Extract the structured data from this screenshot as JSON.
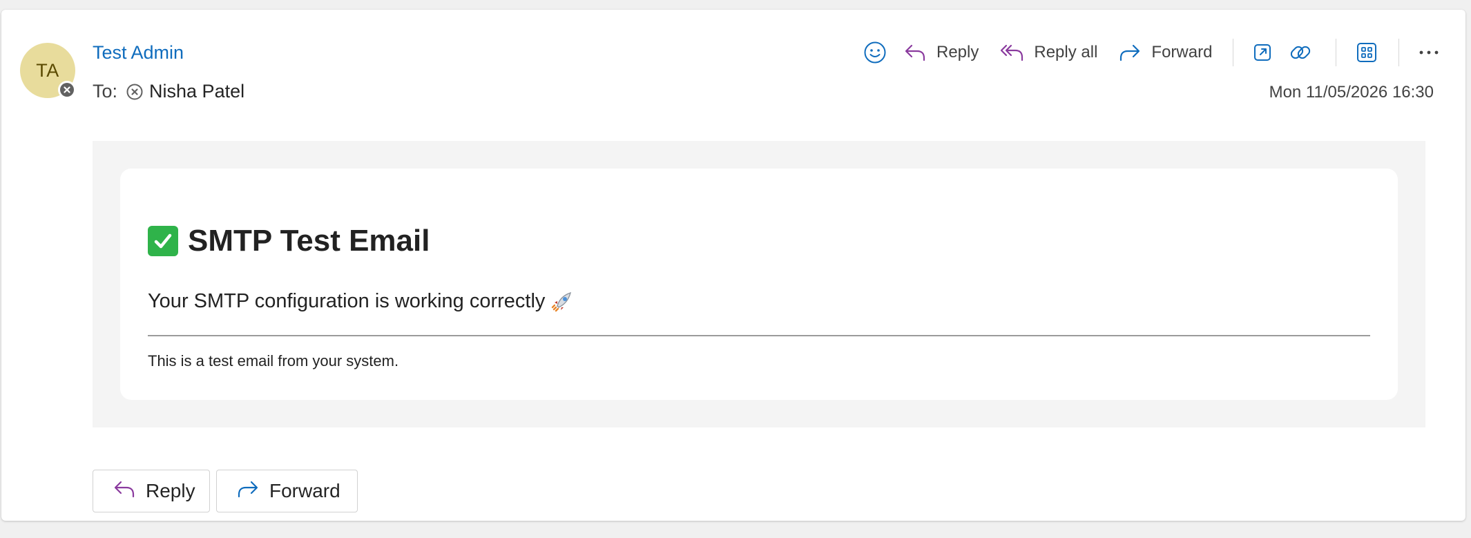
{
  "sender": {
    "initials": "TA",
    "name": "Test Admin",
    "avatar_color": "#e8dc9c"
  },
  "recipients": {
    "label": "To:",
    "names": [
      "Nisha Patel"
    ]
  },
  "timestamp": "Mon 11/05/2026 16:30",
  "toolbar": {
    "emoji_icon": "smiley-icon",
    "reply_label": "Reply",
    "reply_all_label": "Reply all",
    "forward_label": "Forward",
    "more_icon": "more-icon"
  },
  "message": {
    "headline": "SMTP Test Email",
    "body": "Your SMTP configuration is working correctly",
    "footnote": "This is a test email from your system."
  },
  "actions": {
    "reply_label": "Reply",
    "forward_label": "Forward"
  },
  "colors": {
    "accent_blue": "#0f6cbd",
    "reply_purple": "#8a3a9e",
    "check_green": "#2fb34a"
  }
}
